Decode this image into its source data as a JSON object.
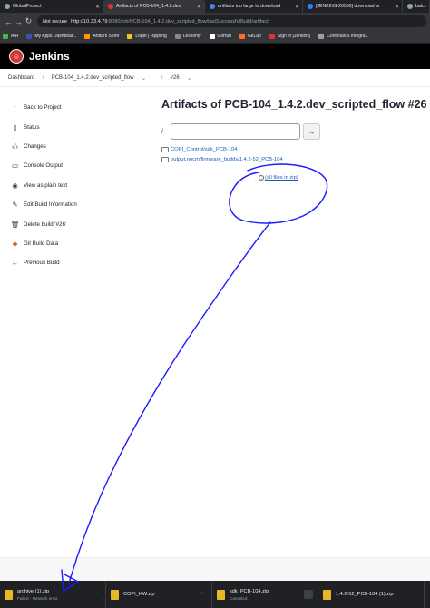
{
  "browser": {
    "tabs": [
      {
        "label": "GlobalProtect",
        "color": "#9aa0a6"
      },
      {
        "label": "Artifacts of PCB-104_1.4.2.dev",
        "color": "#d33833"
      },
      {
        "label": "artifacts too large to download",
        "color": "#4285f4"
      },
      {
        "label": "[JENKINS-20550] download ar",
        "color": "#2684ff"
      },
      {
        "label": "batch",
        "color": "#9aa0a6"
      }
    ],
    "address": {
      "warning": "Not secure",
      "host": "http://10.33.4.79",
      "path": ":8080/job/PCB-104_1.4.2.dev_scripted_flow/lastSuccessfulBuild/artifact/"
    },
    "bookmarks": [
      "AIR",
      "My Apps Dashboar...",
      "Anduril Store",
      "Login | Rippling",
      "Lessonly",
      "GitHub",
      "GitLab",
      "Sign in [Jenkins]",
      "Continuous Integra..."
    ]
  },
  "header": {
    "title": "Jenkins",
    "logo_color": "#d33833"
  },
  "breadcrumbs": [
    "Dashboard",
    "PCB-104_1.4.2.dev_scripted_flow",
    "#26"
  ],
  "sidebar": {
    "items": [
      {
        "label": "Back to Project",
        "icon": "arrow-up-icon",
        "glyph": "↑"
      },
      {
        "label": "Status",
        "icon": "document-icon",
        "glyph": "▯"
      },
      {
        "label": "Changes",
        "icon": "code-icon",
        "glyph": "‹/›"
      },
      {
        "label": "Console Output",
        "icon": "terminal-icon",
        "glyph": "▭"
      },
      {
        "label": "View as plain text",
        "icon": "eye-icon",
        "glyph": "◉"
      },
      {
        "label": "Edit Build Information",
        "icon": "edit-icon",
        "glyph": "✎"
      },
      {
        "label": "Delete build '#26'",
        "icon": "trash-icon",
        "glyph": "🗑"
      },
      {
        "label": "Git Build Data",
        "icon": "git-icon",
        "glyph": "◆"
      },
      {
        "label": "Previous Build",
        "icon": "arrow-left-icon",
        "glyph": "←"
      }
    ]
  },
  "main": {
    "title": "Artifacts of PCB-104_1.4.2.dev_scripted_flow #26",
    "path_prefix": "/",
    "go_glyph": "→",
    "files": [
      "COPI_Control/sdk_PCB-104",
      "output.nocm/firmware_builds/1.4.2-52_PCB-104"
    ],
    "zip_link": "(all files in zip)"
  },
  "downloads": [
    {
      "name": "archive (1).zip",
      "status": "Failed - Network error"
    },
    {
      "name": "COPI_HW.zip",
      "status": ""
    },
    {
      "name": "sdk_PCB-104.zip",
      "status": "Canceled"
    },
    {
      "name": "1.4.2-52_PCB-104 (1).zip",
      "status": ""
    }
  ],
  "annotation_color": "#1a1aff"
}
